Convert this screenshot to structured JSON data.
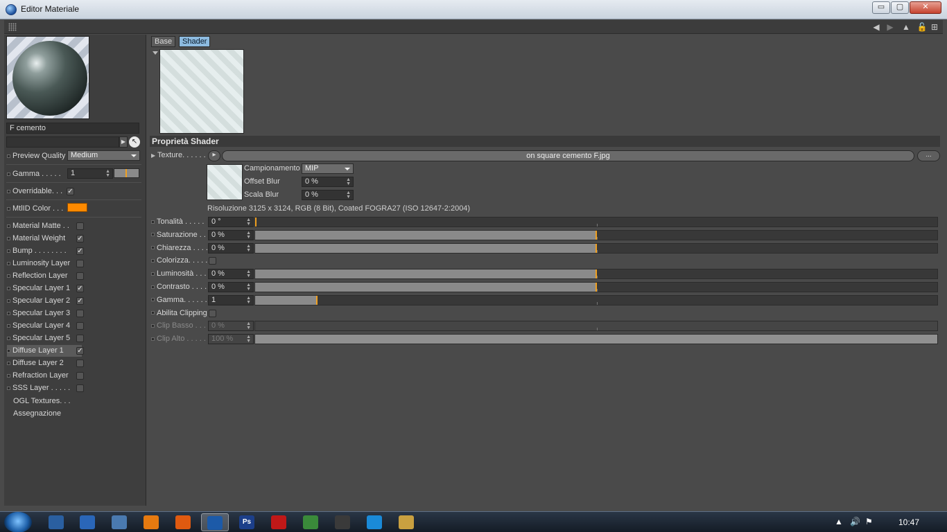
{
  "window": {
    "title": "Editor Materiale",
    "buttons": {
      "minimize": "▭",
      "maximize": "▢",
      "close": "✕"
    }
  },
  "toolbar": {
    "icons": [
      "grip-icon",
      "arrow-left-icon",
      "arrow-right-icon",
      "arrow-up-icon",
      "lock-icon",
      "new-window-icon"
    ]
  },
  "left": {
    "material_name": "F cemento",
    "preview_quality": {
      "label": "Preview Quality",
      "value": "Medium"
    },
    "gamma": {
      "label": "Gamma . . . . .",
      "value": "1"
    },
    "overridable": {
      "label": "Overridable. . .",
      "checked": true
    },
    "mtlid": {
      "label": "MtlID Color . . .",
      "color": "#ff8a00"
    },
    "layers": [
      {
        "label": "Material Matte  . .",
        "checked": false
      },
      {
        "label": "Material Weight",
        "checked": true
      },
      {
        "label": "Bump . . . . . . . .",
        "checked": true
      },
      {
        "label": "Luminosity Layer",
        "checked": false
      },
      {
        "label": "Reflection Layer",
        "checked": false
      },
      {
        "label": "Specular Layer 1",
        "checked": true
      },
      {
        "label": "Specular Layer 2",
        "checked": true
      },
      {
        "label": "Specular Layer 3",
        "checked": false
      },
      {
        "label": "Specular Layer 4",
        "checked": false
      },
      {
        "label": "Specular Layer 5",
        "checked": false
      },
      {
        "label": "Diffuse Layer 1",
        "checked": true,
        "active": true
      },
      {
        "label": "Diffuse Layer 2",
        "checked": false
      },
      {
        "label": "Refraction Layer",
        "checked": false
      },
      {
        "label": "SSS Layer  . . . . .",
        "checked": false
      }
    ],
    "ogl": "OGL Textures. . .",
    "assignment": "Assegnazione"
  },
  "right": {
    "tabs": [
      "Base",
      "Shader"
    ],
    "section_title": "Proprietà Shader",
    "texture": {
      "label": "Texture. . . . . .",
      "file": "on square cemento F.jpg",
      "more_label": "..."
    },
    "sampling": {
      "label": "Campionamento",
      "value": "MIP"
    },
    "offset_blur": {
      "label": "Offset Blur",
      "value": "0 %"
    },
    "scale_blur": {
      "label": "Scala Blur",
      "value": "0 %"
    },
    "info": "Risoluzione 3125 x 3124, RGB (8 Bit), Coated FOGRA27 (ISO 12647-2:2004)",
    "params": [
      {
        "label": "Tonalità  . . . . .",
        "value": "0 °",
        "level": 0.0
      },
      {
        "label": "Saturazione  . .",
        "value": "0 %",
        "level": 0.5
      },
      {
        "label": "Chiarezza  . . . .",
        "value": "0 %",
        "level": 0.5
      },
      {
        "label": "Luminosità  . . .",
        "value": "0 %",
        "level": 0.5
      },
      {
        "label": "Contrasto  . . . .",
        "value": "0 %",
        "level": 0.5
      },
      {
        "label": "Gamma. . . . . .",
        "value": "1",
        "level": 0.09
      }
    ],
    "colorize": {
      "label": "Colorizza. . . . .",
      "checked": false
    },
    "clipping": {
      "label": "Abilita Clipping",
      "checked": false
    },
    "clip_low": {
      "label": "Clip Basso  . . .",
      "value": "0 %",
      "level": 0.0
    },
    "clip_high": {
      "label": "Clip Alto  . . . . .",
      "value": "100 %",
      "level": 1.0
    }
  },
  "taskbar": {
    "apps": [
      "hp-icon",
      "outlook-icon",
      "explorer-remote-icon",
      "vlc-icon",
      "firefox-icon",
      "cinema4d-icon",
      "Ps",
      "acrobat-icon",
      "notepad-icon",
      "maxwell-icon",
      "skype-icon",
      "folder-icon"
    ],
    "time": "10:47"
  },
  "colors": {
    "accent": "#f0a020",
    "tab_active": "#8dbbe0",
    "mtlid": "#ff8a00"
  }
}
